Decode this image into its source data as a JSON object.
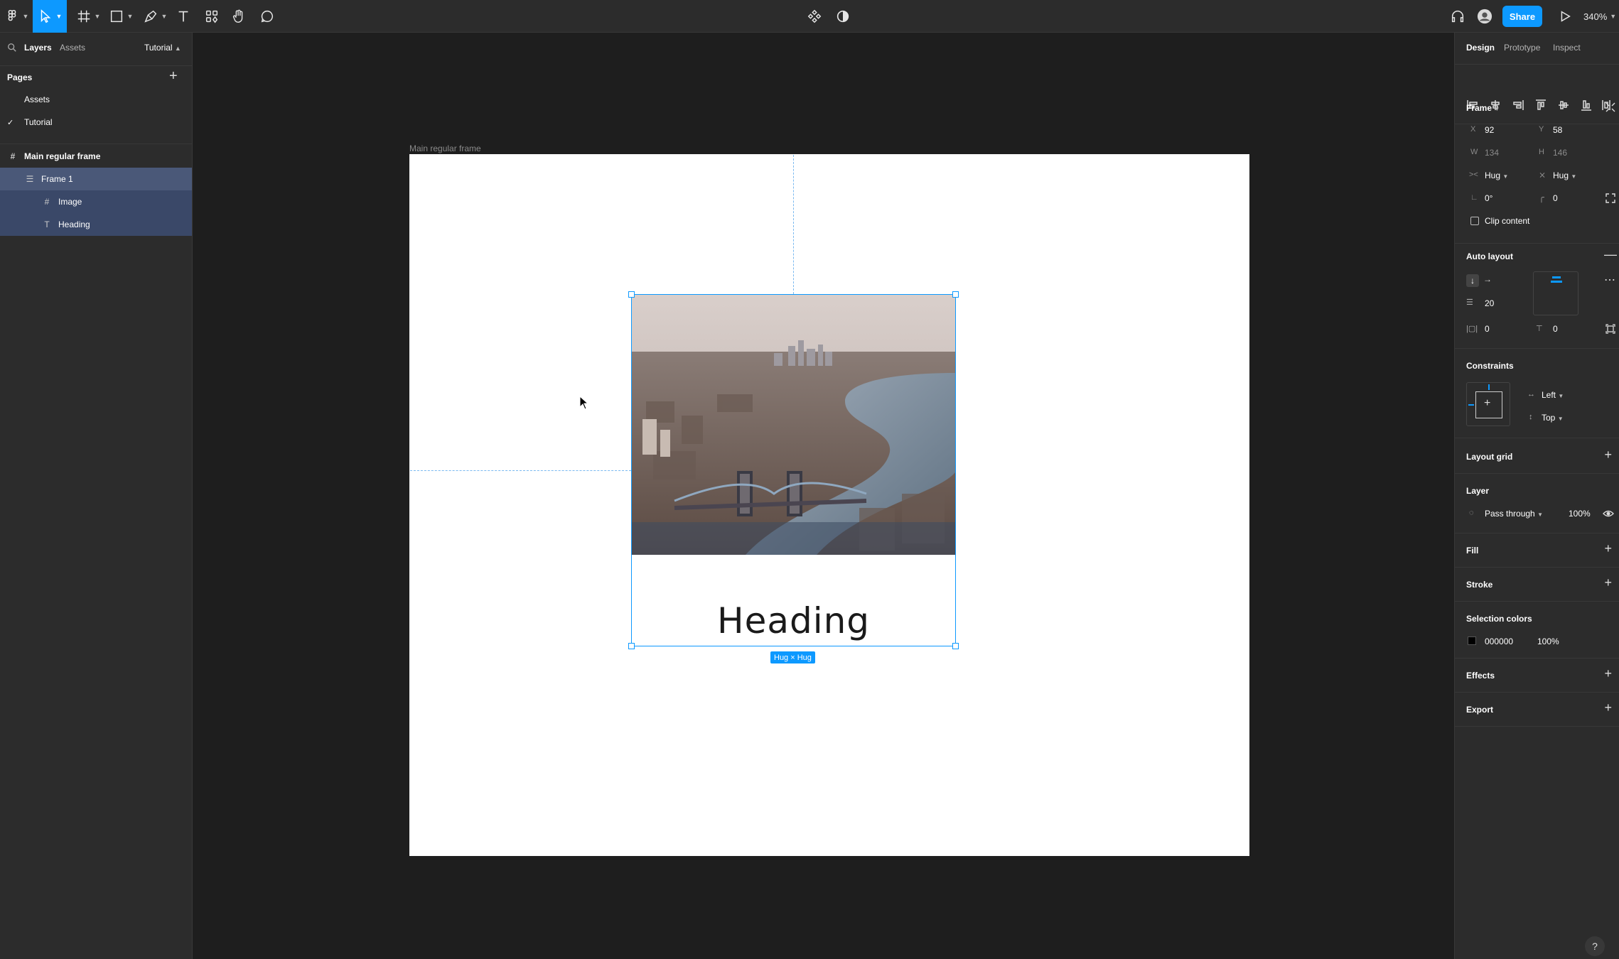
{
  "toolbar": {
    "share_label": "Share",
    "zoom_label": "340%"
  },
  "left_panel": {
    "tabs": [
      "Layers",
      "Assets"
    ],
    "page_dropdown": "Tutorial",
    "pages_title": "Pages",
    "pages": [
      "Assets",
      "Tutorial"
    ],
    "layers": [
      {
        "label": "Main regular frame",
        "icon": "hash-icon"
      },
      {
        "label": "Frame 1",
        "icon": "auto-layout-icon"
      },
      {
        "label": "Image",
        "icon": "hash-icon"
      },
      {
        "label": "Heading",
        "icon": "text-icon"
      }
    ]
  },
  "canvas": {
    "frame_title": "Main regular frame",
    "heading_text": "Heading",
    "hug_badge": "Hug × Hug"
  },
  "right_panel": {
    "tabs": [
      "Design",
      "Prototype",
      "Inspect"
    ],
    "frame": {
      "title": "Frame",
      "x_label": "X",
      "x_value": "92",
      "y_label": "Y",
      "y_value": "58",
      "w_label": "W",
      "w_value": "134",
      "h_label": "H",
      "h_value": "146",
      "h_sizing": "Hug",
      "v_sizing": "Hug",
      "rotation": "0°",
      "radius": "0",
      "clip_content": "Clip content"
    },
    "auto_layout": {
      "title": "Auto layout",
      "spacing": "20",
      "padding_h": "0",
      "padding_v": "0"
    },
    "constraints": {
      "title": "Constraints",
      "horizontal": "Left",
      "vertical": "Top"
    },
    "layout_grid": "Layout grid",
    "layer": {
      "title": "Layer",
      "blend": "Pass through",
      "opacity": "100%"
    },
    "fill": "Fill",
    "stroke": "Stroke",
    "selection_colors": {
      "title": "Selection colors",
      "hex": "000000",
      "opacity": "100%"
    },
    "effects": "Effects",
    "export": "Export"
  },
  "colors": {
    "accent": "#0d99ff",
    "panel": "#2c2c2c",
    "canvas": "#1e1e1e",
    "selection_row": "#4a5878"
  }
}
